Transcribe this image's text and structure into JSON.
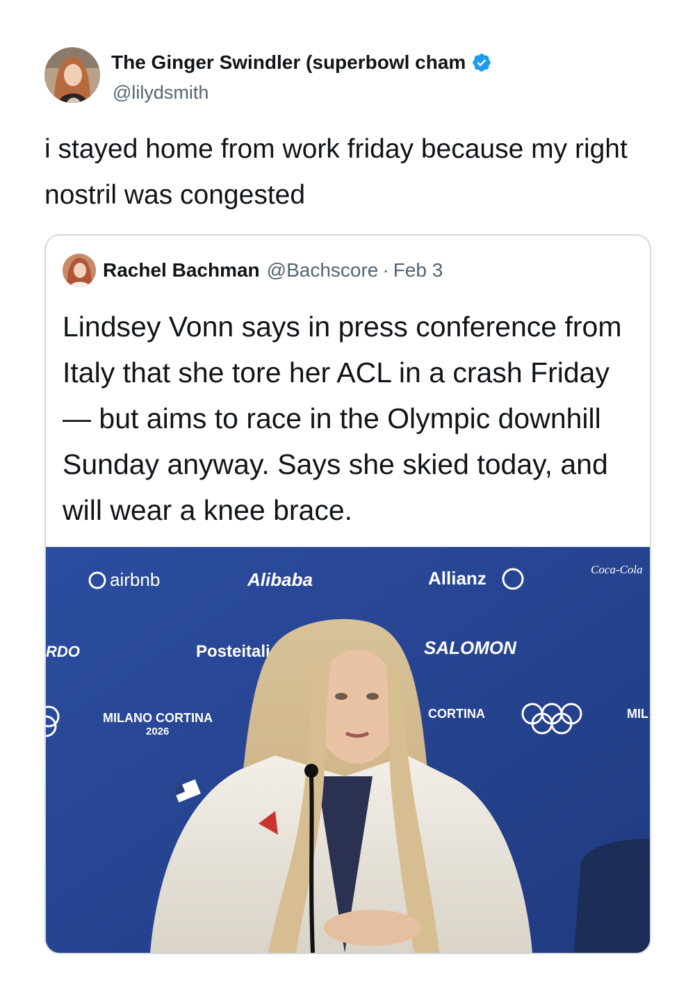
{
  "author": {
    "display_name": "The Ginger Swindler (superbowl cham",
    "handle": "@lilydsmith",
    "verified": true,
    "avatar_icon": "user-avatar-icon"
  },
  "tweet": {
    "text": "i stayed home from work friday because my right nostril was congested"
  },
  "quoted_tweet": {
    "display_name": "Rachel Bachman",
    "handle": "@Bachscore",
    "separator": "·",
    "date": "Feb 3",
    "text": "Lindsey Vonn says in press conference from Italy that she tore her ACL in a crash Friday — but aims to race in the Olympic downhill Sunday anyway. Says she skied today, and will wear a knee brace.",
    "media": {
      "sponsor_texts": [
        "airbnb",
        "Alibaba",
        "Allianz",
        "Coca-Cola",
        "Posteitaliane",
        "SALOMON",
        "RDO",
        "MILANO CORTINA",
        "2026",
        "CORTINA",
        "MIL"
      ]
    }
  },
  "colors": {
    "verified": "#1d9bf0",
    "secondary_text": "#536471",
    "border": "#cfd9de",
    "backdrop_blue": "#25428c"
  }
}
